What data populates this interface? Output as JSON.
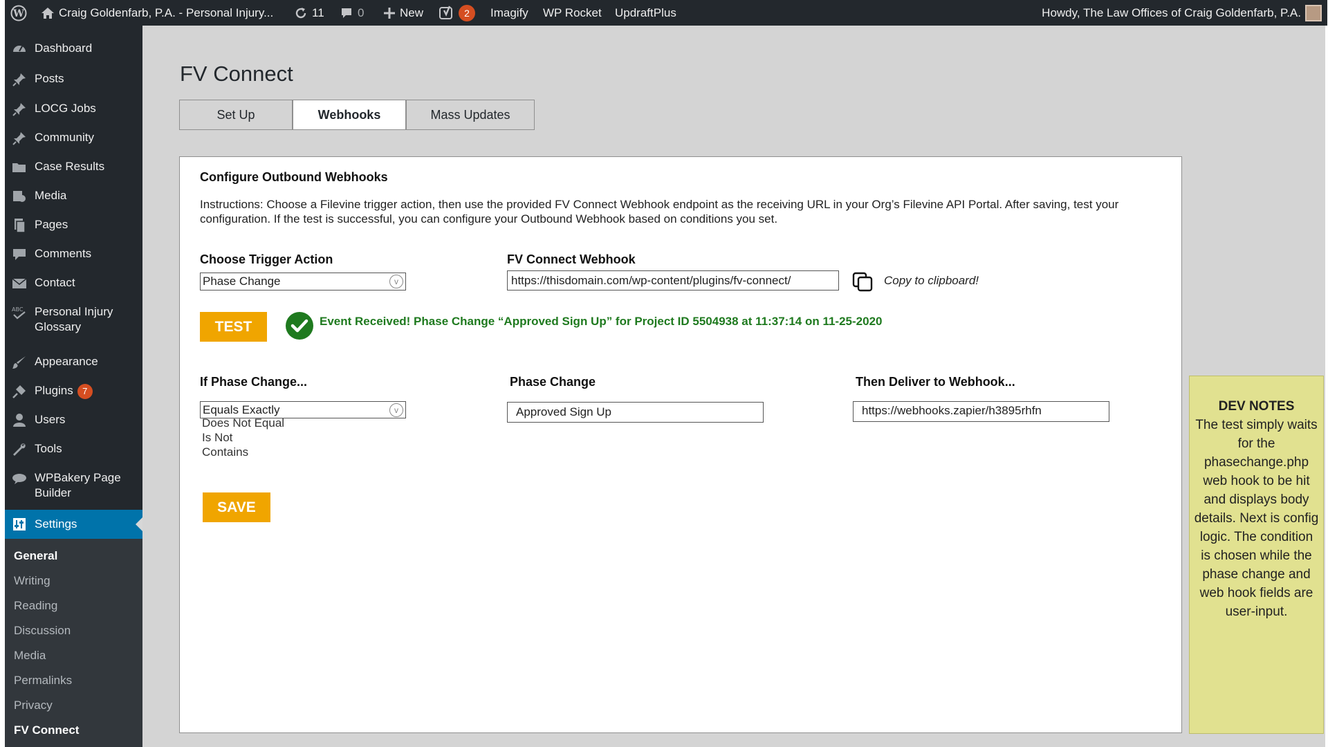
{
  "admin_bar": {
    "site_title": "Craig Goldenfarb, P.A. - Personal Injury...",
    "updates_count": "11",
    "comments_count": "0",
    "new_label": "New",
    "yoast_badge": "2",
    "imagify_label": "Imagify",
    "wp_rocket_label": "WP Rocket",
    "updraft_label": "UpdraftPlus",
    "howdy": "Howdy, The Law Offices of Craig Goldenfarb, P.A."
  },
  "sidebar": {
    "items": [
      {
        "label": "Dashboard",
        "icon": "dashboard-icon"
      },
      {
        "label": "Posts",
        "icon": "pin-icon"
      },
      {
        "label": "LOCG Jobs",
        "icon": "pin-icon"
      },
      {
        "label": "Community",
        "icon": "pin-icon"
      },
      {
        "label": "Case Results",
        "icon": "folder-icon"
      },
      {
        "label": "Media",
        "icon": "media-icon"
      },
      {
        "label": "Pages",
        "icon": "pages-icon"
      },
      {
        "label": "Comments",
        "icon": "comment-icon"
      },
      {
        "label": "Contact",
        "icon": "mail-icon"
      },
      {
        "label": "Personal Injury Glossary",
        "icon": "spellcheck-icon"
      },
      {
        "label": "Appearance",
        "icon": "brush-icon"
      },
      {
        "label": "Plugins",
        "icon": "plug-icon",
        "badge": "7"
      },
      {
        "label": "Users",
        "icon": "user-icon"
      },
      {
        "label": "Tools",
        "icon": "wrench-icon"
      },
      {
        "label": "WPBakery Page Builder",
        "icon": "cloud-icon"
      },
      {
        "label": "Settings",
        "icon": "settings-icon"
      }
    ],
    "submenu": [
      "General",
      "Writing",
      "Reading",
      "Discussion",
      "Media",
      "Permalinks",
      "Privacy",
      "FV Connect"
    ]
  },
  "page": {
    "title": "FV Connect",
    "tabs": [
      "Set Up",
      "Webhooks",
      "Mass Updates"
    ],
    "active_tab": "Webhooks"
  },
  "webhooks": {
    "heading": "Configure Outbound Webhooks",
    "instructions": "Instructions: Choose a Filevine trigger action, then use the provided FV Connect Webhook endpoint as the receiving URL in your Org’s Filevine API Portal. After saving, test your configuration. If the test is successful, you can configure your Outbound Webhook based on conditions you set.",
    "trigger_label": "Choose Trigger Action",
    "trigger_value": "Phase Change",
    "webhook_label": "FV Connect Webhook",
    "webhook_value": "https://thisdomain.com/wp-content/plugins/fv-connect/",
    "copy_label": "Copy to clipboard!",
    "test_button": "TEST",
    "status_message": "Event Received! Phase Change “Approved Sign Up” for Project ID 5504938 at 11:37:14 on 11-25-2020",
    "condition_label": "If Phase Change...",
    "condition_value": "Equals Exactly",
    "condition_options": [
      "Does Not Equal",
      "Is Not",
      "Contains"
    ],
    "phase_label": "Phase Change",
    "phase_value": "Approved Sign Up",
    "deliver_label": "Then Deliver to Webhook...",
    "deliver_value": "https://webhooks.zapier/h3895rhfn",
    "save_button": "SAVE"
  },
  "dev_notes": {
    "title": "DEV NOTES",
    "body": "The test simply waits for the phasechange.php web hook to be hit and displays body details. Next is config logic. The condition is chosen while the phase change and web hook fields are user-input."
  },
  "colors": {
    "admin_dark": "#23282d",
    "admin_blue": "#0073aa",
    "accent_orange": "#f0a500",
    "success_green": "#1f7a1f",
    "notes_yellow": "#e1e190"
  }
}
